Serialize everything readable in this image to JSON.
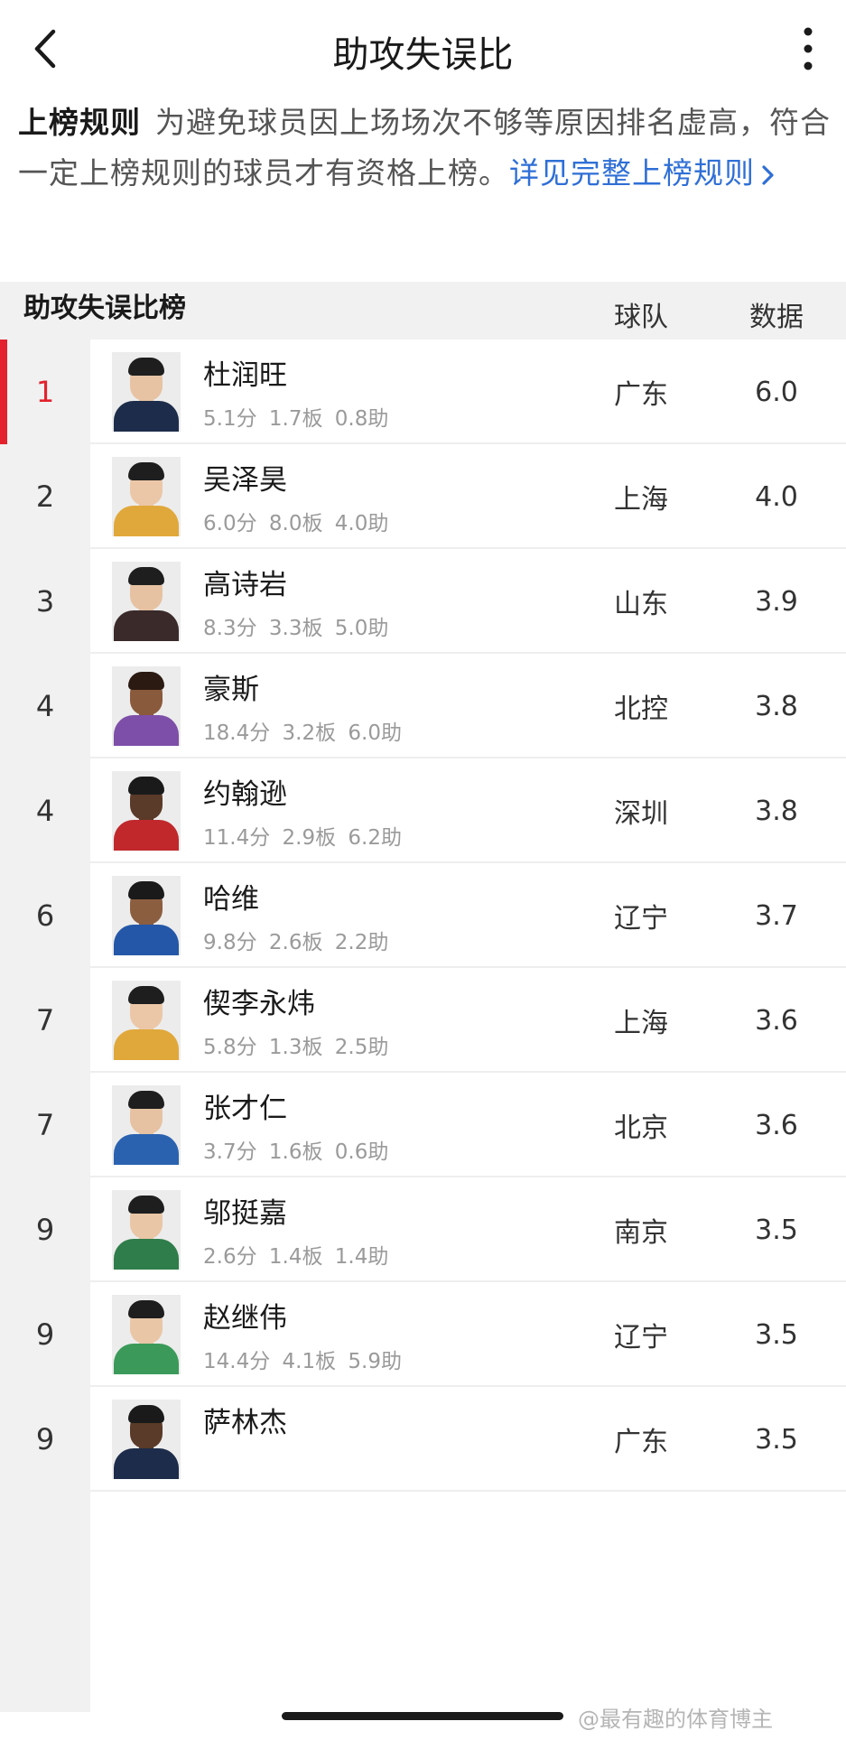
{
  "header": {
    "title": "助攻失误比",
    "back_icon": "chevron-left-icon",
    "more_icon": "more-vertical-icon"
  },
  "rules": {
    "title": "上榜规则",
    "text": "为避免球员因上场场次不够等原因排名虚高，符合一定上榜规则的球员才有资格上榜。",
    "link": "详见完整上榜规则",
    "link_icon": "chevron-right-icon"
  },
  "table": {
    "title": "助攻失误比榜",
    "col_team": "球队",
    "col_stat": "数据"
  },
  "players": [
    {
      "rank": "1",
      "name": "杜润旺",
      "stats": "5.1分 1.7板 0.8助",
      "team": "广东",
      "value": "6.0",
      "jersey": "#1d2c4a",
      "skin": "#e7c3a3",
      "hair": "#1e1e1e"
    },
    {
      "rank": "2",
      "name": "吴泽昊",
      "stats": "6.0分 8.0板 4.0助",
      "team": "上海",
      "value": "4.0",
      "jersey": "#e0a83a",
      "skin": "#ebc7a8",
      "hair": "#1e1e1e"
    },
    {
      "rank": "3",
      "name": "高诗岩",
      "stats": "8.3分 3.3板 5.0助",
      "team": "山东",
      "value": "3.9",
      "jersey": "#3a2a2a",
      "skin": "#e6c2a2",
      "hair": "#1e1e1e"
    },
    {
      "rank": "4",
      "name": "豪斯",
      "stats": "18.4分 3.2板 6.0助",
      "team": "北控",
      "value": "3.8",
      "jersey": "#7d4fa8",
      "skin": "#8a5a3c",
      "hair": "#2a1a12"
    },
    {
      "rank": "4",
      "name": "约翰逊",
      "stats": "11.4分 2.9板 6.2助",
      "team": "深圳",
      "value": "3.8",
      "jersey": "#c0282c",
      "skin": "#5a3a28",
      "hair": "#1a1a1a"
    },
    {
      "rank": "6",
      "name": "哈维",
      "stats": "9.8分 2.6板 2.2助",
      "team": "辽宁",
      "value": "3.7",
      "jersey": "#2457a8",
      "skin": "#8c5e40",
      "hair": "#1a1a1a"
    },
    {
      "rank": "7",
      "name": "偰李永炜",
      "stats": "5.8分 1.3板 2.5助",
      "team": "上海",
      "value": "3.6",
      "jersey": "#e0a83a",
      "skin": "#ebc7a8",
      "hair": "#1e1e1e"
    },
    {
      "rank": "7",
      "name": "张才仁",
      "stats": "3.7分 1.6板 0.6助",
      "team": "北京",
      "value": "3.6",
      "jersey": "#2a62b0",
      "skin": "#e6c2a2",
      "hair": "#1e1e1e"
    },
    {
      "rank": "9",
      "name": "邬挺嘉",
      "stats": "2.6分 1.4板 1.4助",
      "team": "南京",
      "value": "3.5",
      "jersey": "#2f7d4a",
      "skin": "#e9c6a6",
      "hair": "#1e1e1e"
    },
    {
      "rank": "9",
      "name": "赵继伟",
      "stats": "14.4分 4.1板 5.9助",
      "team": "辽宁",
      "value": "3.5",
      "jersey": "#3b9a5a",
      "skin": "#e9c6a6",
      "hair": "#1e1e1e"
    },
    {
      "rank": "9",
      "name": "萨林杰",
      "stats": "",
      "team": "广东",
      "value": "3.5",
      "jersey": "#1d2c4a",
      "skin": "#5a3a28",
      "hair": "#1a1a1a"
    }
  ],
  "watermark": "@最有趣的体育博主"
}
